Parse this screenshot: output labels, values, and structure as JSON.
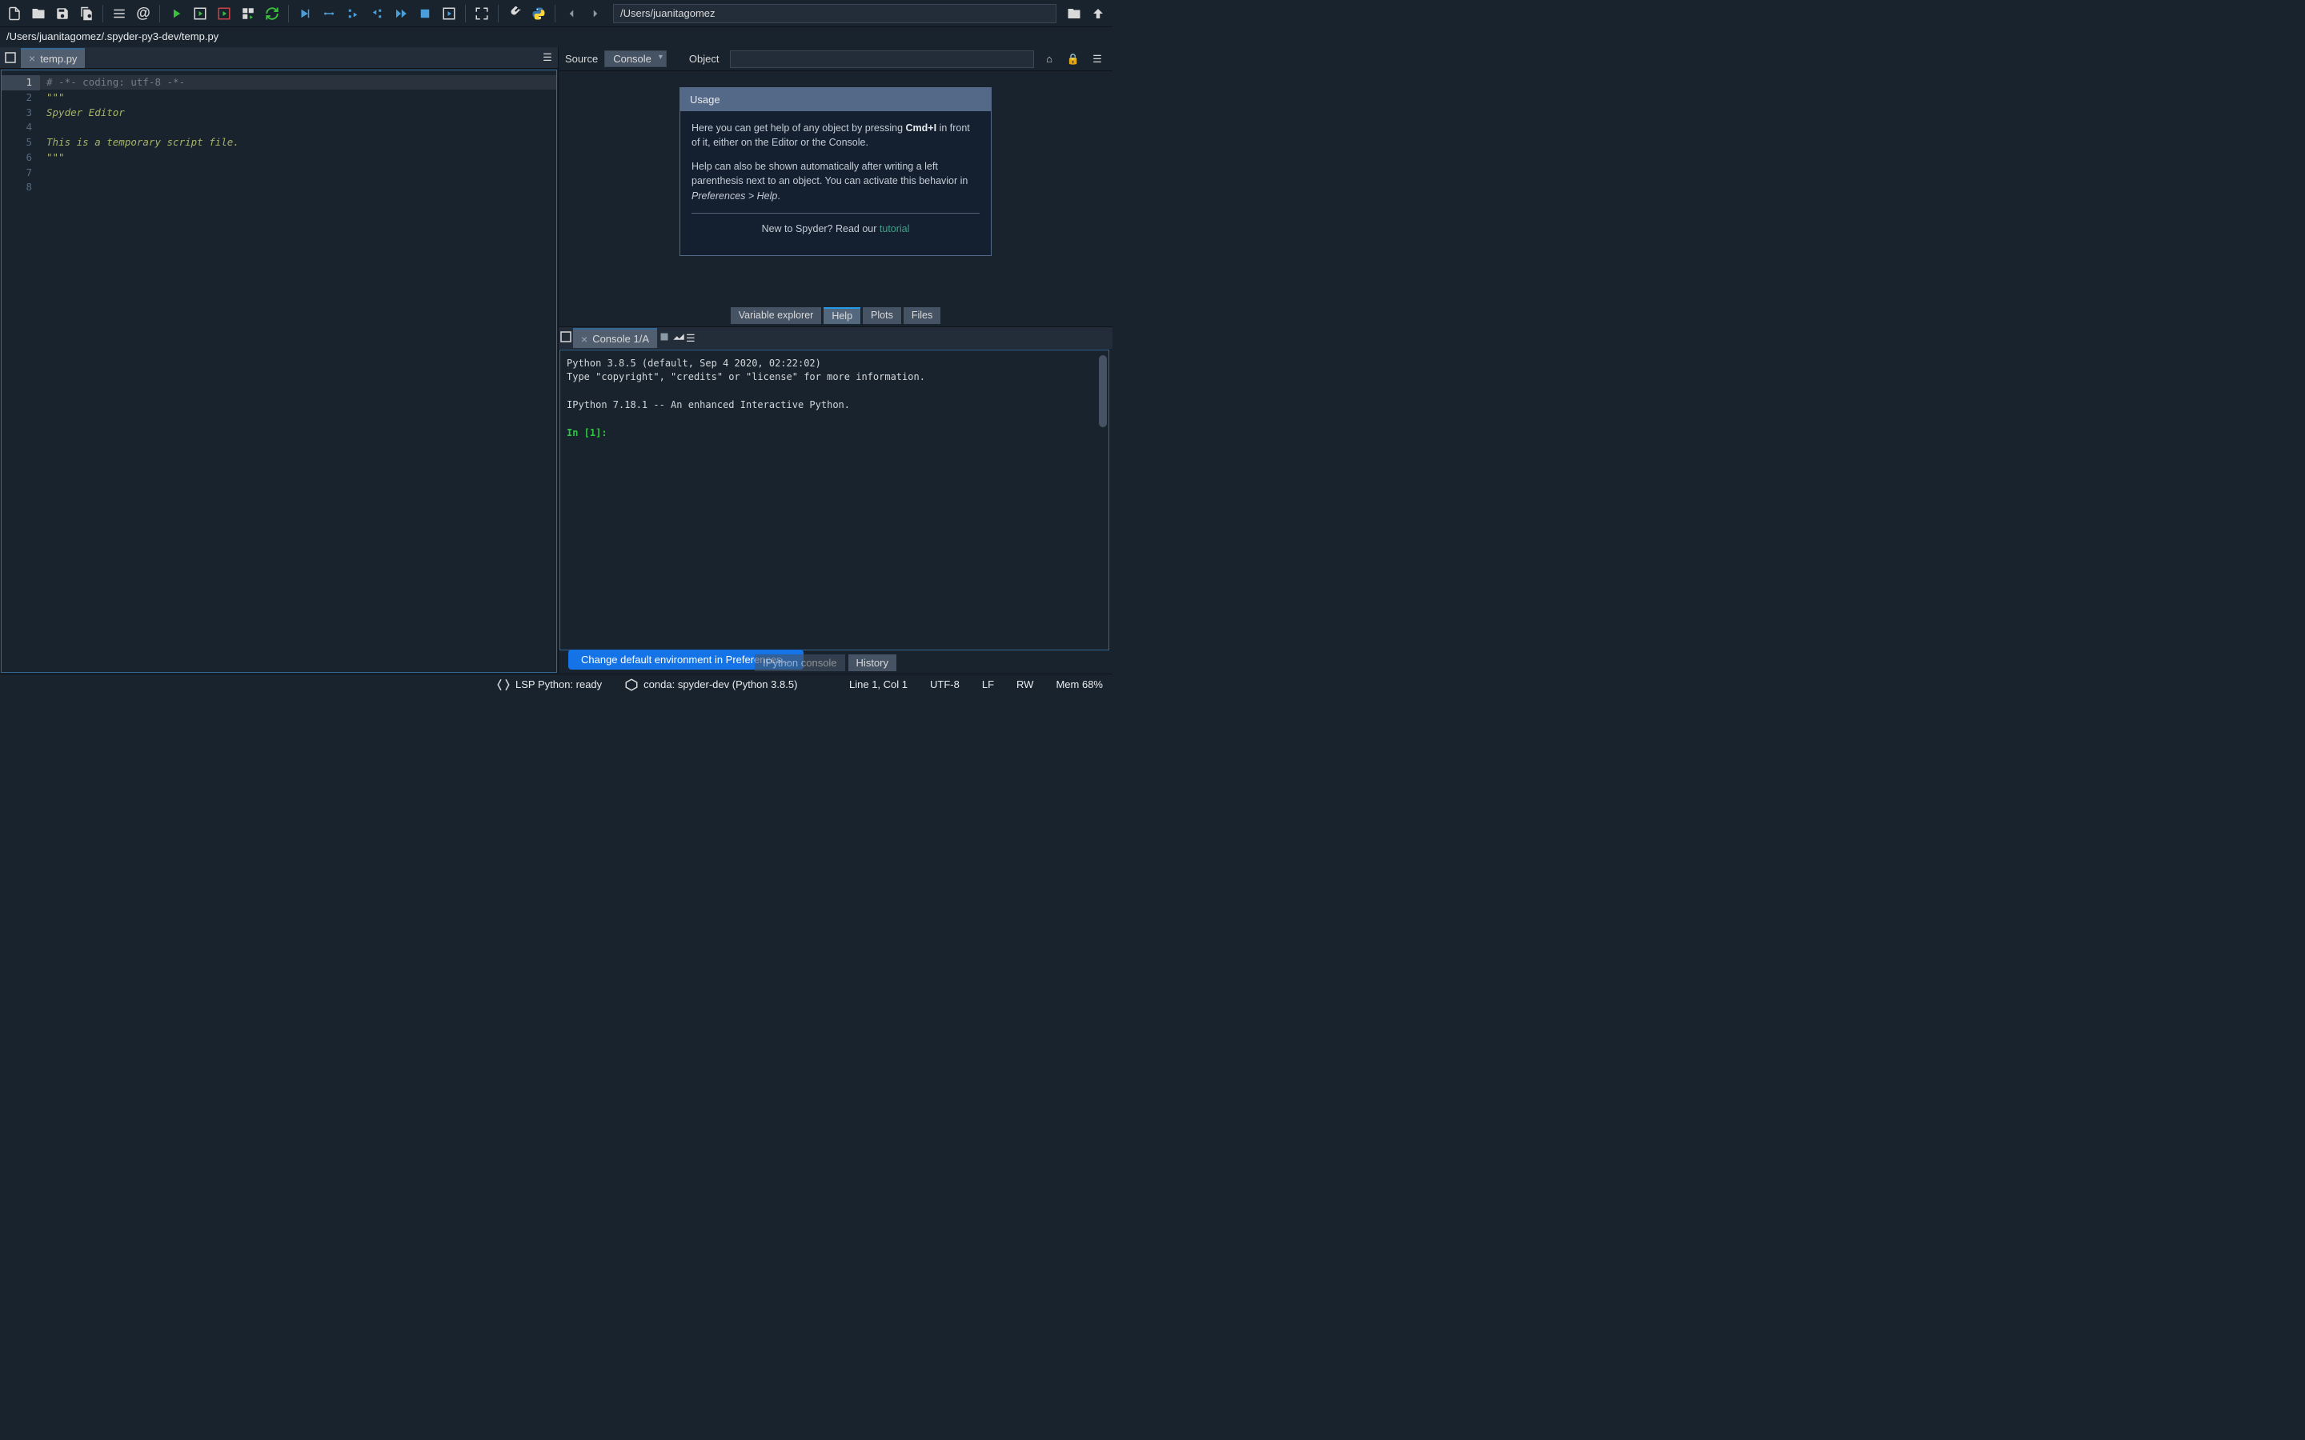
{
  "toolbar": {
    "path": "/Users/juanitagomez"
  },
  "breadcrumb": "/Users/juanitagomez/.spyder-py3-dev/temp.py",
  "editor": {
    "tab": "temp.py",
    "lines": [
      "1",
      "2",
      "3",
      "4",
      "5",
      "6",
      "7",
      "8"
    ],
    "code": {
      "l1": "# -*- coding: utf-8 -*-",
      "l2": "\"\"\"",
      "l3": "Spyder Editor",
      "l4": "",
      "l5": "This is a temporary script file.",
      "l6": "\"\"\""
    }
  },
  "help": {
    "source_label": "Source",
    "source_combo": "Console",
    "object_label": "Object",
    "usage_title": "Usage",
    "p1a": "Here you can get help of any object by pressing ",
    "p1b": "Cmd+I",
    "p1c": " in front of it, either on the Editor or the Console.",
    "p2a": "Help can also be shown automatically after writing a left parenthesis next to an object. You can activate this behavior in ",
    "p2b": "Preferences > Help",
    "p2c": ".",
    "p3a": "New to Spyder? Read our ",
    "p3b": "tutorial",
    "tabs": {
      "vexp": "Variable explorer",
      "help": "Help",
      "plots": "Plots",
      "files": "Files"
    }
  },
  "console": {
    "tab": "Console 1/A",
    "banner1": "Python 3.8.5 (default, Sep  4 2020, 02:22:02)",
    "banner2": "Type \"copyright\", \"credits\" or \"license\" for more information.",
    "banner3": "IPython 7.18.1 -- An enhanced Interactive Python.",
    "prompt": "In [1]:",
    "bottom_tabs": {
      "ipy": "IPython console",
      "hist": "History"
    }
  },
  "notification": "Change default environment in Preferences...",
  "status": {
    "lsp": "LSP Python: ready",
    "conda": "conda: spyder-dev (Python 3.8.5)",
    "pos": "Line 1, Col 1",
    "enc": "UTF-8",
    "eol": "LF",
    "rw": "RW",
    "mem": "Mem 68%"
  }
}
